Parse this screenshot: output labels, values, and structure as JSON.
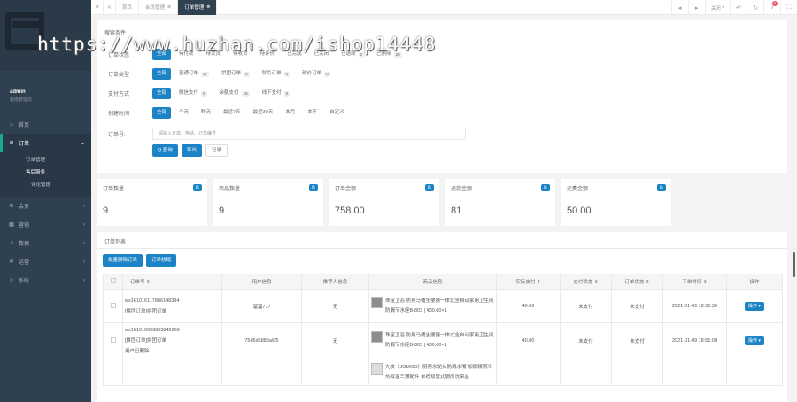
{
  "sidebar": {
    "user": {
      "name": "admin",
      "role": "超级管理员"
    },
    "items": [
      {
        "icon": "home-icon",
        "label": "首页"
      },
      {
        "icon": "list-icon",
        "label": "订单",
        "subs": [
          "订单管理",
          "售后服务",
          "评论管理"
        ]
      },
      {
        "icon": "gear-icon",
        "label": "会员"
      },
      {
        "icon": "grid-icon",
        "label": "营销"
      },
      {
        "icon": "chart-icon",
        "label": "数据"
      },
      {
        "icon": "cog-icon",
        "label": "运营"
      },
      {
        "icon": "user-icon",
        "label": "系统"
      }
    ]
  },
  "topbar": {
    "tabs": [
      "首页",
      "会员管理",
      "订单管理"
    ],
    "close_label": "关闭",
    "badge": "8"
  },
  "search": {
    "title": "搜索条件",
    "rows": [
      {
        "label": "订单状态",
        "options": [
          {
            "t": "全部",
            "c": ""
          },
          {
            "t": "待付款",
            "c": ""
          },
          {
            "t": "待发货",
            "c": ""
          },
          {
            "t": "待收货",
            "c": ""
          },
          {
            "t": "待评价",
            "c": ""
          },
          {
            "t": "已完成",
            "c": ""
          },
          {
            "t": "已关闭",
            "c": ""
          },
          {
            "t": "已退款",
            "c": "2"
          },
          {
            "t": "已删除",
            "c": "28"
          }
        ]
      },
      {
        "label": "订单类型",
        "options": [
          {
            "t": "全部",
            "c": ""
          },
          {
            "t": "普通订单",
            "c": "37"
          },
          {
            "t": "拼团订单",
            "c": "0"
          },
          {
            "t": "秒杀订单",
            "c": "0"
          },
          {
            "t": "砍价订单",
            "c": "0"
          }
        ]
      },
      {
        "label": "支付方式",
        "options": [
          {
            "t": "全部",
            "c": ""
          },
          {
            "t": "微信支付",
            "c": "0"
          },
          {
            "t": "余额支付",
            "c": "15"
          },
          {
            "t": "线下支付",
            "c": "0"
          }
        ]
      },
      {
        "label": "创建时间",
        "options": [
          {
            "t": "全部",
            "c": ""
          },
          {
            "t": "今天",
            "c": ""
          },
          {
            "t": "昨天",
            "c": ""
          },
          {
            "t": "最近7天",
            "c": ""
          },
          {
            "t": "最近30天",
            "c": ""
          },
          {
            "t": "本月",
            "c": ""
          },
          {
            "t": "本年",
            "c": ""
          },
          {
            "t": "自定义",
            "c": ""
          }
        ]
      }
    ],
    "order_label": "订单号:",
    "order_placeholder": "请输入订单、电话、订单编号",
    "query_btn": "Q 查询",
    "export_btn": "导出",
    "record_btn": "记录"
  },
  "stats": [
    {
      "title": "订单数量",
      "badge": "总",
      "value": "9"
    },
    {
      "title": "商品数量",
      "badge": "总",
      "value": "9"
    },
    {
      "title": "订单金额",
      "badge": "总",
      "value": "758.00"
    },
    {
      "title": "退款金额",
      "badge": "总",
      "value": "81"
    },
    {
      "title": "运费金额",
      "badge": "总",
      "value": "50.00"
    }
  ],
  "list": {
    "title": "订单列表",
    "batch_btn": "批量删除订单",
    "ship_btn": "订单核销",
    "headers": [
      "订单号",
      "用户信息",
      "推荐人信息",
      "商品信息",
      "实际支付",
      "支付状态",
      "订单状态",
      "下单时间",
      "操作"
    ],
    "rows": [
      {
        "no": "wx161016117886148394",
        "type": "[拼团订单]拼团订单",
        "extra": "",
        "user": "溜溜717",
        "ref": "无",
        "goods": "珠宝卫浴 防臭马桶坐便器一体式全自动家用卫生间防漏节水座B-803 | ¥30.00×1",
        "pay": "40.00",
        "pstatus": "未支付",
        "ostatus": "未支付",
        "time": "2021-01-09 18:50:30",
        "op": "操作"
      },
      {
        "no": "wx161016056855842669",
        "type": "[拼团订单]拼团订单",
        "extra": "用户已删除",
        "user": "75d6d6886a6/5",
        "ref": "无",
        "goods": "珠宝卫浴 防臭马桶坐便器一体式全自动家用卫生间防漏节水座B-803 | ¥30.00×1",
        "pay": "40.00",
        "pstatus": "未支付",
        "ostatus": "未支付",
        "time": "2021-01-09 18:51:08",
        "op": "操作"
      },
      {
        "no": "",
        "type": "",
        "extra": "",
        "user": "",
        "ref": "",
        "goods": "九牧（JOMOO）厨房水龙头防溅水嘴 加厚精铜冷热双温三通配件 单把双管式厨房洗菜盆",
        "pay": "",
        "pstatus": "",
        "ostatus": "",
        "time": "",
        "op": ""
      }
    ]
  },
  "watermark": "https://www.huzhan.com/ishop14448"
}
